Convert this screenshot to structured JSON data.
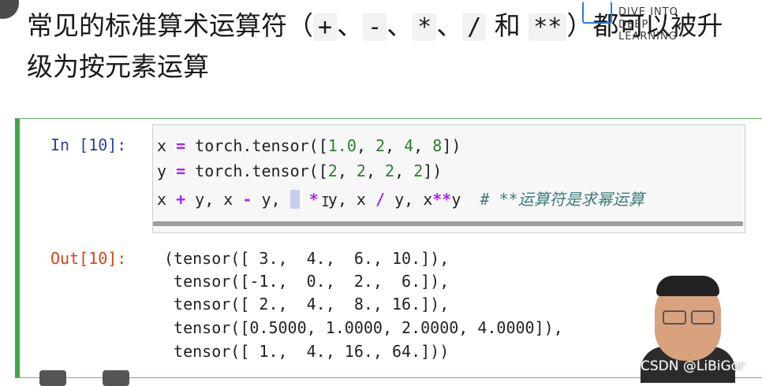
{
  "heading": {
    "part1": "常见的标准算术运算符（",
    "op_plus": "+",
    "sep1": "、",
    "op_minus": "-",
    "sep2": "、",
    "op_mul": "*",
    "sep3": "、",
    "op_div": "/",
    "and_word": " 和 ",
    "op_pow": "**",
    "part2": "）都可以被升级为按元素运算"
  },
  "logo": {
    "line1": "DIVE INTO",
    "line2": "DEEP LEARNING"
  },
  "in_prompt": "In [10]:",
  "out_prompt": "Out[10]:",
  "code": {
    "line1": {
      "var": "x ",
      "op": "=",
      "call": " torch.tensor([",
      "n1": "1.0",
      "c1": ", ",
      "n2": "2",
      "c2": ", ",
      "n3": "4",
      "c3": ", ",
      "n4": "8",
      "end": "])"
    },
    "line2": {
      "var": "y ",
      "op": "=",
      "call": " torch.tensor([",
      "n1": "2",
      "c1": ", ",
      "n2": "2",
      "c2": ", ",
      "n3": "2",
      "c3": ", ",
      "n4": "2",
      "end": "])"
    },
    "line3": {
      "a": "x ",
      "op1": "+",
      "b": " y, x ",
      "op2": "-",
      "c": " y, ",
      "hl": " ",
      "d": " ",
      "op3": "*",
      "e": " y, x ",
      "op4": "/",
      "f": " y, x",
      "op5": "**",
      "g": "y  ",
      "comment": "# **运算符是求幂运算"
    }
  },
  "output_lines": [
    "(tensor([ 3.,  4.,  6., 10.]),",
    " tensor([-1.,  0.,  2.,  6.]),",
    " tensor([ 2.,  4.,  8., 16.]),",
    " tensor([0.5000, 1.0000, 2.0000, 4.0000]),",
    " tensor([ 1.,  4., 16., 64.]))"
  ],
  "watermark": "CSDN @LiBiGor"
}
